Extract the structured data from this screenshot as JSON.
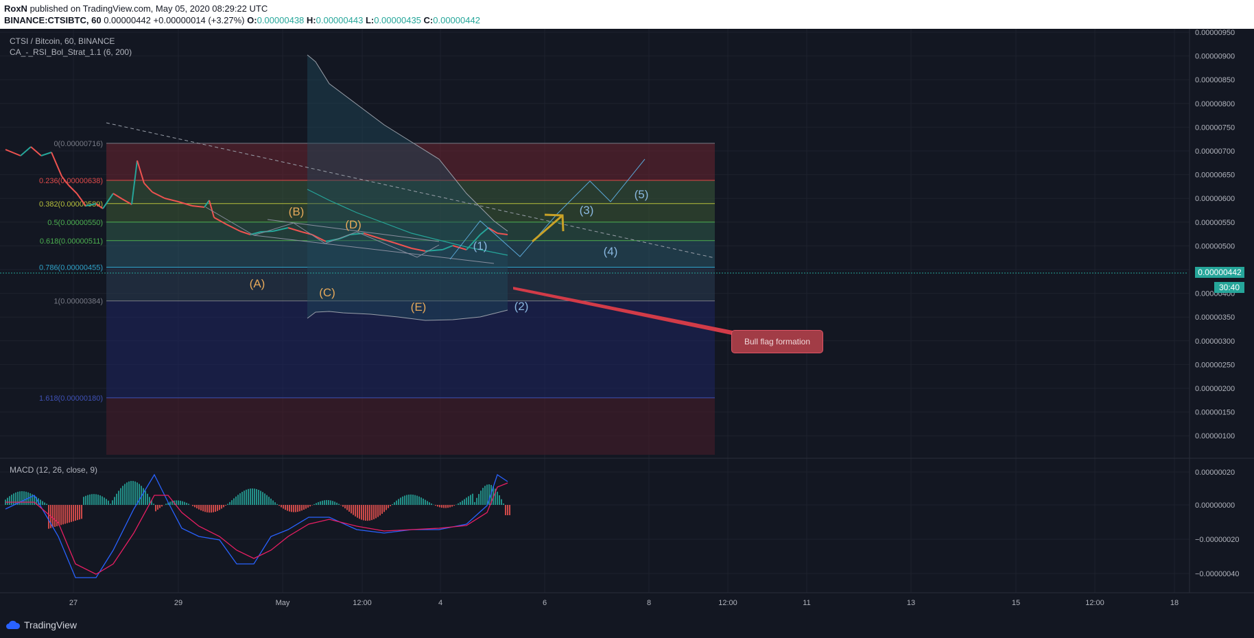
{
  "header": {
    "author": "RoxN",
    "published": "published on TradingView.com, May 05, 2020 08:29:22 UTC",
    "symbol_line_prefix": "BINANCE:CTSIBTC, 60",
    "last_price": "0.00000442",
    "change": "+0.00000014 (+3.27%)",
    "o_label": "O:",
    "o_value": "0.00000438",
    "h_label": "H:",
    "h_value": "0.00000443",
    "l_label": "L:",
    "l_value": "0.00000435",
    "c_label": "C:",
    "c_value": "0.00000442"
  },
  "chart": {
    "title": "CTSI / Bitcoin, 60, BINANCE",
    "indicator": "CA_-_RSI_Bol_Strat_1.1 (6, 200)",
    "macd_title": "MACD (12, 26, close, 9)",
    "price_axis_labels": [
      "0.00000950",
      "0.00000900",
      "0.00000850",
      "0.00000800",
      "0.00000750",
      "0.00000700",
      "0.00000650",
      "0.00000600",
      "0.00000550",
      "0.00000500",
      "0.00000450",
      "0.00000400",
      "0.00000350",
      "0.00000300",
      "0.00000250",
      "0.00000200",
      "0.00000150",
      "0.00000100"
    ],
    "macd_axis_labels": [
      "0.00000020",
      "0.00000000",
      "−0.00000020",
      "−0.00000040"
    ],
    "time_axis_labels": [
      "27",
      "29",
      "May",
      "12:00",
      "4",
      "6",
      "8",
      "12:00",
      "11",
      "13",
      "15",
      "12:00",
      "18"
    ],
    "current_price_badge": "0.00000442",
    "countdown_badge": "30:40",
    "fib_levels": [
      {
        "label": "0(0.00000716)",
        "color": "#787b86"
      },
      {
        "label": "0.236(0.00000638)",
        "color": "#e04a4a"
      },
      {
        "label": "0.382(0.00000589)",
        "color": "#b8c13c"
      },
      {
        "label": "0.5(0.00000550)",
        "color": "#4caf50"
      },
      {
        "label": "0.618(0.00000511)",
        "color": "#4caf50"
      },
      {
        "label": "0.786(0.00000455)",
        "color": "#2fa3c9"
      },
      {
        "label": "1(0.00000384)",
        "color": "#787b86"
      },
      {
        "label": "1.618(0.00000180)",
        "color": "#3f51b5"
      }
    ],
    "wave_labels_abc": [
      "(A)",
      "(B)",
      "(C)",
      "(D)",
      "(E)"
    ],
    "wave_labels_impulse": [
      "(1)",
      "(2)",
      "(3)",
      "(4)",
      "(5)"
    ],
    "callout": "Bull flag formation"
  },
  "footer": {
    "brand": "TradingView"
  }
}
